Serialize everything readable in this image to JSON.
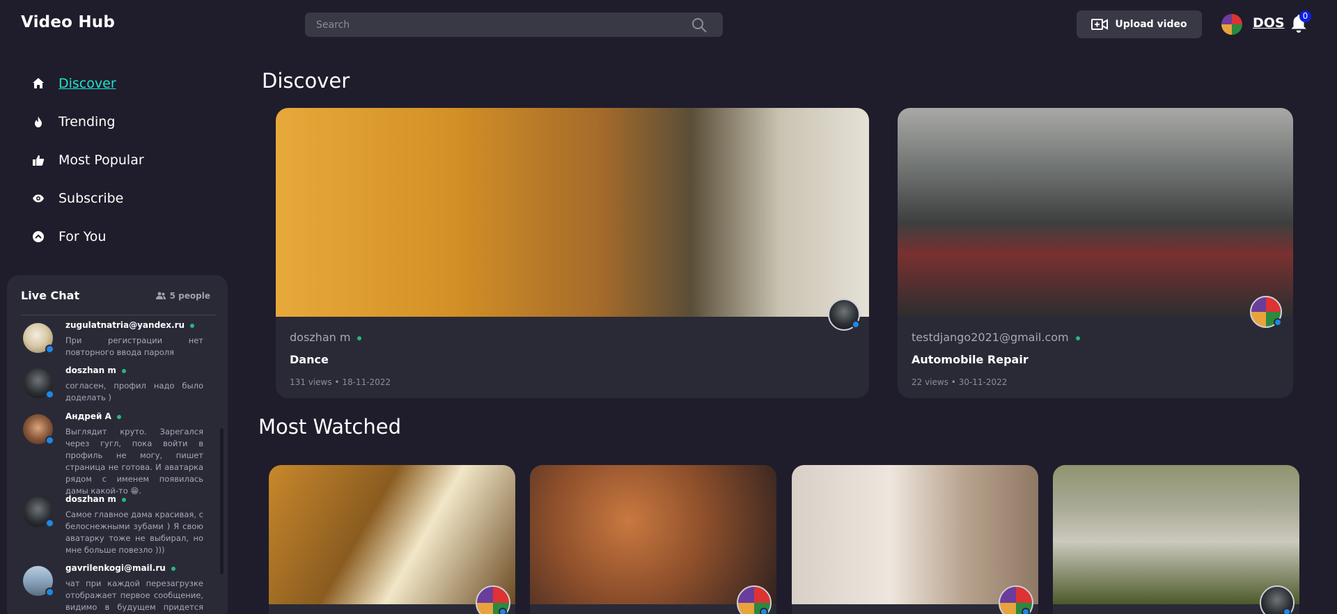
{
  "header": {
    "logo": "Video Hub",
    "search_placeholder": "Search",
    "upload_label": "Upload video",
    "username": "DOS",
    "notification_count": "0"
  },
  "nav": {
    "items": [
      {
        "label": "Discover",
        "icon": "home-icon",
        "active": true
      },
      {
        "label": "Trending",
        "icon": "flame-icon"
      },
      {
        "label": "Most Popular",
        "icon": "thumbs-up-icon"
      },
      {
        "label": "Subscribe",
        "icon": "eye-icon"
      },
      {
        "label": "For You",
        "icon": "chevron-up-circle-icon"
      }
    ]
  },
  "chat": {
    "title": "Live Chat",
    "people": "5 people",
    "messages": [
      {
        "name": "zugulatnatria@yandex.ru",
        "text": "При регистрации нет повторного ввода пароля"
      },
      {
        "name": "doszhan m",
        "text": "согласен, профил надо было доделать )"
      },
      {
        "name": "Андрей А",
        "text": "Выглядит круто. Зарегался через гугл, пока войти в профиль не могу, пишет страница не готова. И аватарка рядом с именем появилась дамы какой-то 😁."
      },
      {
        "name": "doszhan m",
        "text": "Самое главное дама красивая, с белоснежными зубами ) Я свою аватарку тоже не выбирал, но мне больше повезло )))"
      },
      {
        "name": "gavrilenkogi@mail.ru",
        "text": "чат при каждой перезагрузке отображает первое сообщение, видимо в будущем придется всю"
      }
    ]
  },
  "main": {
    "discover_heading": "Discover",
    "most_watched_heading": "Most Watched",
    "discover_videos": [
      {
        "author": "doszhan m",
        "title": "Dance",
        "views": "131 views",
        "date": "18-11-2022"
      },
      {
        "author": "testdjango2021@gmail.com",
        "title": "Automobile Repair",
        "views": "22 views",
        "date": "30-11-2022"
      }
    ]
  }
}
